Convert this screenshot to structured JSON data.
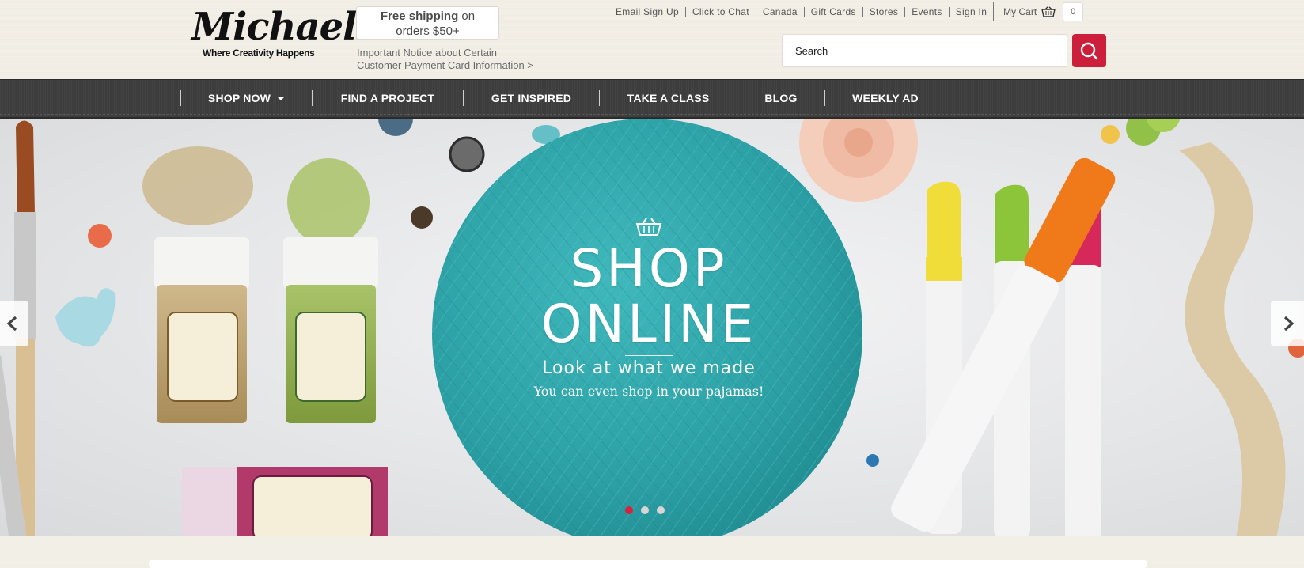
{
  "brand": {
    "name": "Michaels",
    "tagline": "Where Creativity Happens"
  },
  "shipping": {
    "bold": "Free shipping",
    "rest": " on",
    "line2": "orders $50+"
  },
  "notice": {
    "line1": "Important Notice about Certain",
    "line2": "Customer Payment Card Information >"
  },
  "utility_links": [
    "Email Sign Up",
    "Click to Chat",
    "Canada",
    "Gift Cards",
    "Stores",
    "Events",
    "Sign In"
  ],
  "cart": {
    "label": "My Cart",
    "count": "0",
    "icon": "basket-icon"
  },
  "search": {
    "placeholder": "Search",
    "button_icon": "search-icon"
  },
  "nav": [
    {
      "label": "SHOP NOW",
      "dropdown": true
    },
    {
      "label": "FIND A PROJECT"
    },
    {
      "label": "GET INSPIRED"
    },
    {
      "label": "TAKE A CLASS"
    },
    {
      "label": "BLOG"
    },
    {
      "label": "WEEKLY AD"
    }
  ],
  "hero": {
    "title1": "SHOP",
    "title2": "ONLINE",
    "subtitle": "Look at what we made",
    "subtitle2": "You can even shop in your pajamas!",
    "slides": 3,
    "active_slide": 1
  },
  "colors": {
    "accent": "#cc1f3b",
    "nav_bg": "#3d3d3d",
    "yarn": "#2aa3a8"
  }
}
